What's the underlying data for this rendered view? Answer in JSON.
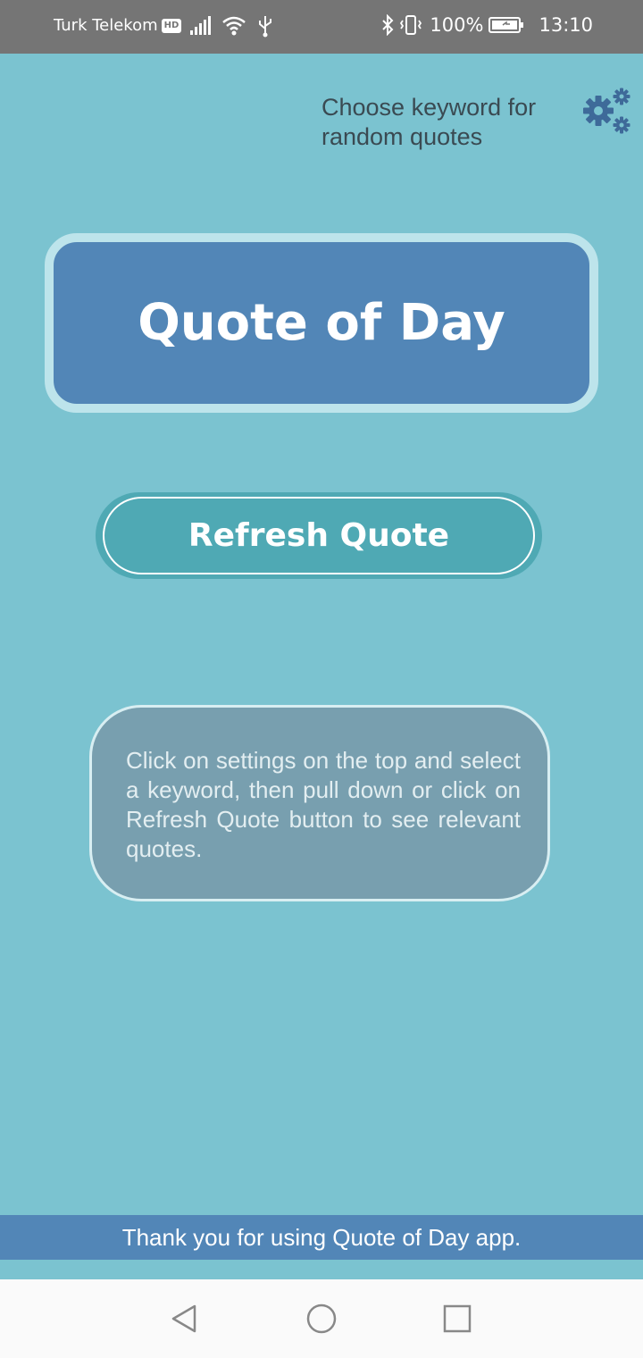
{
  "status_bar": {
    "carrier": "Turk Telekom",
    "hd_badge": "HD",
    "battery": "100%",
    "time": "13:10",
    "icons": [
      "signal-icon",
      "wifi-icon",
      "usb-icon",
      "bluetooth-icon",
      "vibrate-icon",
      "battery-icon"
    ]
  },
  "header": {
    "keyword_hint": "Choose keyword for random quotes",
    "settings_icon": "gears-icon"
  },
  "title_card": {
    "title": "Quote of Day"
  },
  "refresh_button": {
    "label": "Refresh Quote"
  },
  "info_box": {
    "text": "Click on settings on the top and select a keyword, then pull down or click on Refresh Quote button to see relevant quotes."
  },
  "footer": {
    "text": "Thank you for using Quote of Day app."
  },
  "nav_bar": {
    "buttons": [
      "back-icon",
      "home-icon",
      "recents-icon"
    ]
  },
  "colors": {
    "background": "#7BC3D0",
    "title_card": "#5286B7",
    "title_border": "#BDE4EB",
    "button": "#4FA9B4",
    "info_box": "#789FAF",
    "footer": "#5286B7",
    "status_bar": "#757575"
  }
}
